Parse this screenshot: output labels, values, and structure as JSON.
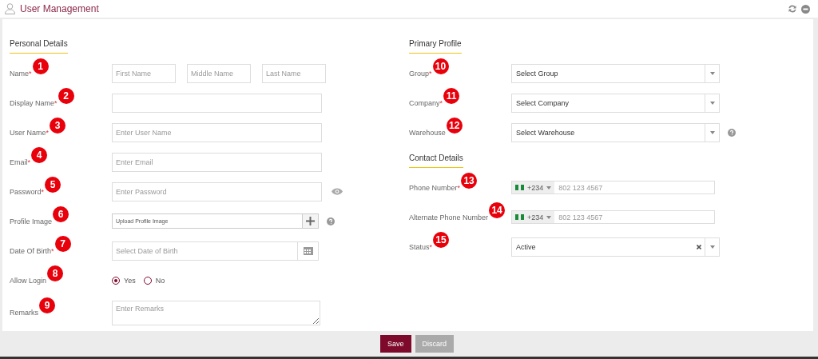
{
  "header": {
    "title": "User Management"
  },
  "personal": {
    "heading": "Personal Details",
    "fields": [
      {
        "kind": "name",
        "label": "Name",
        "required_mark": "*",
        "marker": "1",
        "placeholders": [
          "First Name",
          "Middle Name",
          "Last Name"
        ]
      },
      {
        "kind": "text",
        "label": "Display Name",
        "required_mark": "*",
        "marker": "2"
      },
      {
        "kind": "text",
        "label": "User Name",
        "required_mark": "*",
        "marker": "3",
        "placeholder": "Enter User Name"
      },
      {
        "kind": "text",
        "label": "Email",
        "required_mark": "*",
        "marker": "4",
        "placeholder": "Enter Email"
      },
      {
        "kind": "password",
        "label": "Password",
        "required_mark": "*",
        "marker": "5",
        "placeholder": "Enter Password"
      },
      {
        "kind": "upload",
        "label": "Profile Image",
        "marker": "6",
        "placeholder": "Upload Profile Image",
        "help": true
      },
      {
        "kind": "date",
        "label": "Date Of Birth",
        "required_mark": "*",
        "marker": "7",
        "placeholder": "Select Date of Birth"
      },
      {
        "kind": "radio",
        "label": "Allow Login",
        "marker": "8",
        "options": [
          {
            "label": "Yes",
            "selected": true
          },
          {
            "label": "No",
            "selected": false
          }
        ]
      },
      {
        "kind": "textarea",
        "label": "Remarks",
        "marker": "9",
        "placeholder": "Enter Remarks"
      }
    ]
  },
  "primary": {
    "heading": "Primary Profile",
    "fields": [
      {
        "kind": "select",
        "label": "Group",
        "required_mark": "*",
        "marker": "10",
        "placeholder": "Select Group"
      },
      {
        "kind": "select",
        "label": "Company",
        "required_mark": "*",
        "marker": "11",
        "placeholder": "Select Company"
      },
      {
        "kind": "select",
        "label": "Warehouse",
        "marker": "12",
        "placeholder": "Select Warehouse",
        "help": true
      }
    ]
  },
  "contact": {
    "heading": "Contact Details",
    "fields": [
      {
        "kind": "phone",
        "label": "Phone Number",
        "required_mark": "*",
        "marker": "13",
        "dial_code": "+234",
        "placeholder": "802 123 4567"
      },
      {
        "kind": "phone",
        "label": "Alternate Phone Number",
        "marker": "14",
        "dial_code": "+234",
        "placeholder": "802 123 4567"
      },
      {
        "kind": "select",
        "label": "Status",
        "required_mark": "*",
        "marker": "15",
        "value": "Active",
        "clearable": true
      }
    ]
  },
  "buttons": [
    {
      "label": "Save",
      "kind": "primary"
    },
    {
      "label": "Discard",
      "kind": "secondary"
    }
  ]
}
